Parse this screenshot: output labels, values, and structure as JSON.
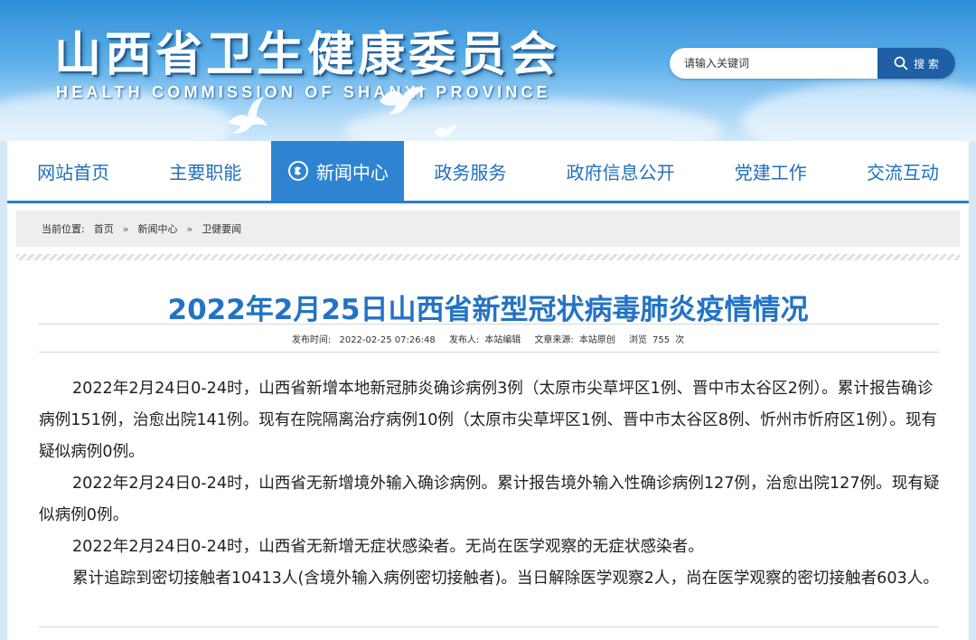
{
  "header": {
    "title": "山西省卫生健康委员会",
    "subtitle": "HEALTH COMMISSION OF SHANXI PROVINCE"
  },
  "search": {
    "placeholder": "请输入关键词",
    "button_label": "搜 索"
  },
  "nav": {
    "items": [
      {
        "label": "网站首页"
      },
      {
        "label": "主要职能"
      },
      {
        "label": "新闻中心"
      },
      {
        "label": "政务服务"
      },
      {
        "label": "政府信息公开"
      },
      {
        "label": "党建工作"
      },
      {
        "label": "交流互动"
      }
    ],
    "active_index": 2
  },
  "breadcrumb": {
    "prefix": "当前位置:",
    "items": [
      "首页",
      "新闻中心",
      "卫健要闻"
    ],
    "separator": "»"
  },
  "article": {
    "title": "2022年2月25日山西省新型冠状病毒肺炎疫情情况",
    "meta": {
      "publish_time_label": "发布时间:",
      "publish_time": "2022-02-25 07:26:48",
      "publisher_label": "发布人:",
      "publisher": "本站编辑",
      "source_label": "文章来源:",
      "source": "本站原创",
      "views_label": "浏览",
      "views": "755",
      "views_unit": "次"
    },
    "paragraphs": [
      "2022年2月24日0-24时，山西省新增本地新冠肺炎确诊病例3例（太原市尖草坪区1例、晋中市太谷区2例）。累计报告确诊病例151例，治愈出院141例。现有在院隔离治疗病例10例（太原市尖草坪区1例、晋中市太谷区8例、忻州市忻府区1例）。现有疑似病例0例。",
      "2022年2月24日0-24时，山西省无新增境外输入确诊病例。累计报告境外输入性确诊病例127例，治愈出院127例。现有疑似病例0例。",
      "2022年2月24日0-24时，山西省无新增无症状感染者。无尚在医学观察的无症状感染者。",
      "累计追踪到密切接触者10413人(含境外输入病例密切接触者)。当日解除医学观察2人，尚在医学观察的密切接触者603人。"
    ]
  },
  "colors": {
    "brand_blue": "#2f84d2",
    "nav_text": "#1f6fbf",
    "title_blue": "#2373c4",
    "search_button": "#1e5fa6"
  },
  "icons": {
    "search": "magnifier-icon",
    "nav_active": "globe-icon",
    "decoration": "dove-icon"
  }
}
